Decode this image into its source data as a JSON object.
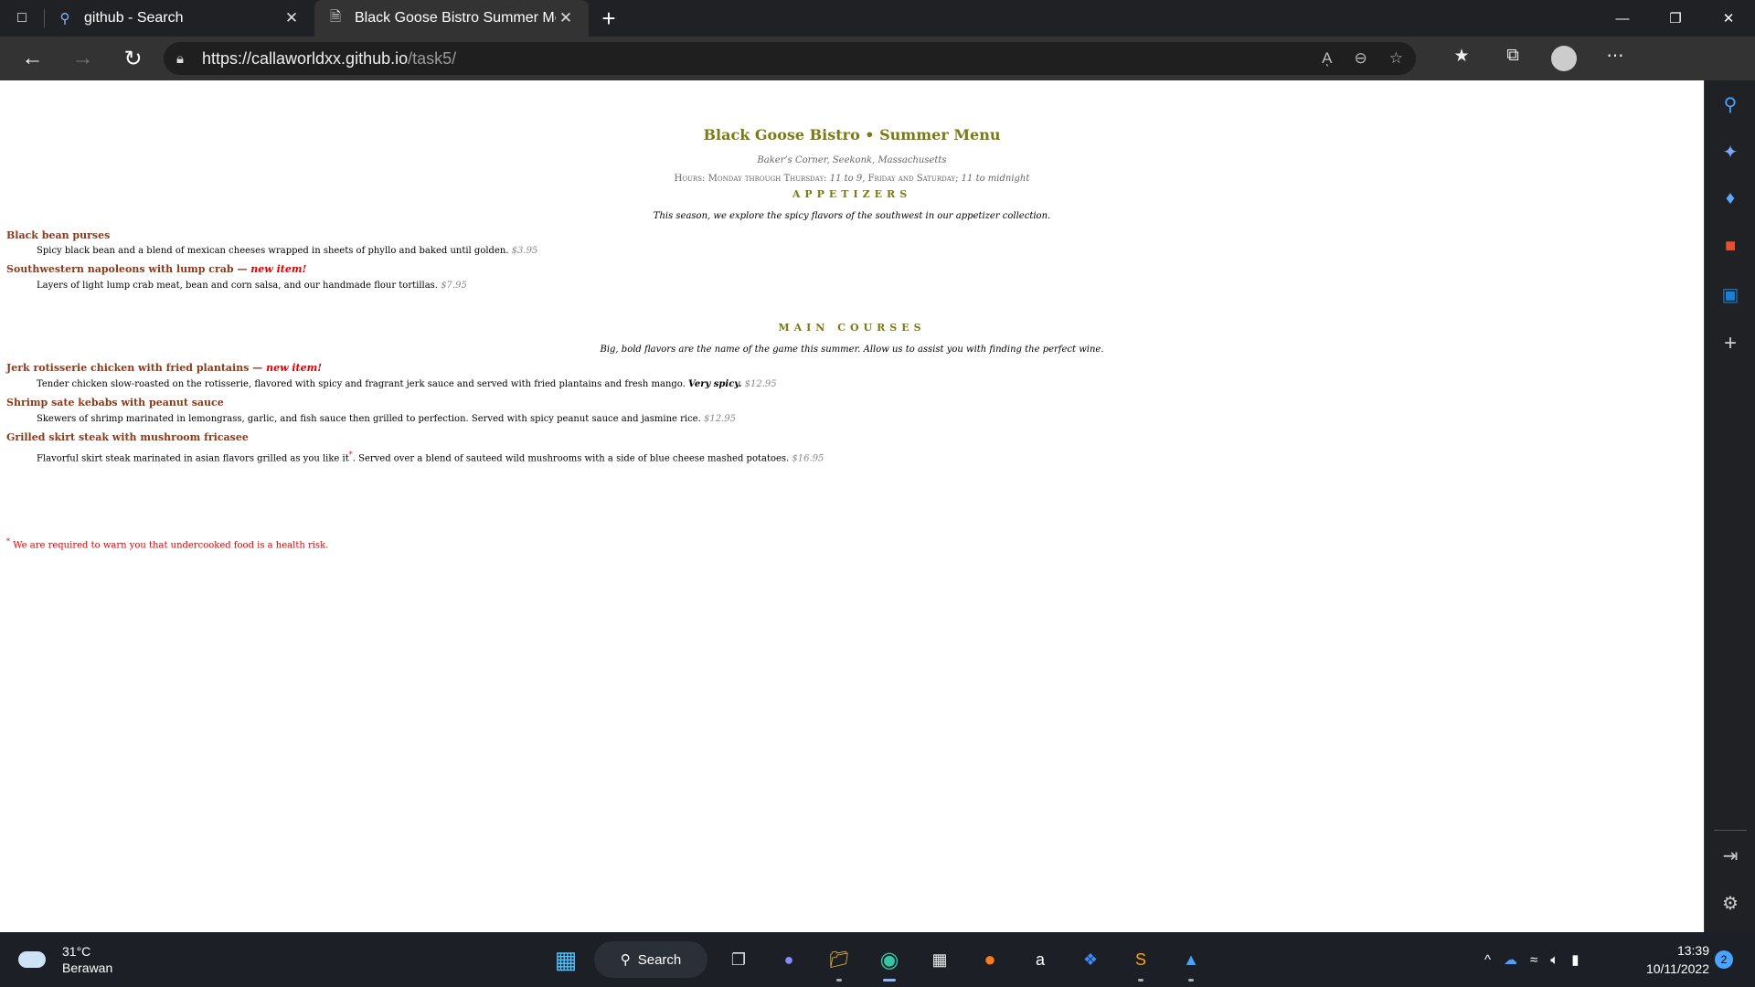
{
  "browser": {
    "tabs": [
      {
        "title": "github - Search"
      },
      {
        "title": "Black Goose Bistro Summer Menu"
      }
    ],
    "url_host": "https://callaworldxx.github.io",
    "url_path": "/task5/",
    "read_aloud_label": "Aͅ",
    "colors": {
      "chrome": "#202124",
      "toolbar": "#333333"
    }
  },
  "page": {
    "title": "Black Goose Bistro • Summer Menu",
    "address": "Baker’s Corner, Seekonk, Massachusetts",
    "hours_label": "Hours: Monday through Thursday:",
    "hours_weekday": "11 to 9,",
    "hours_weekend_label": "Friday and Saturday;",
    "hours_weekend": "11 to midnight",
    "appetizers": {
      "heading": "APPETIZERS",
      "intro": "This season, we explore the spicy flavors of the southwest in our appetizer collection.",
      "items": [
        {
          "name": "Black bean purses",
          "new": "",
          "desc": "Spicy black bean and a blend of mexican cheeses wrapped in sheets of phyllo and baked until golden.",
          "price": "$3.95"
        },
        {
          "name": "Southwestern napoleons with lump crab —",
          "new": "new item!",
          "desc": "Layers of light lump crab meat, bean and corn salsa, and our handmade flour tortillas.",
          "price": "$7.95"
        }
      ]
    },
    "main_courses": {
      "heading": "MAIN COURSES",
      "intro": "Big, bold flavors are the name of the game this summer. Allow us to assist you with finding the perfect wine.",
      "items": [
        {
          "name": "Jerk rotisserie chicken with fried plantains —",
          "new": "new item!",
          "desc": "Tender chicken slow-roasted on the rotisserie, flavored with spicy and fragrant jerk sauce and served with fried plantains and fresh mango.",
          "emph": "Very spicy.",
          "price": "$12.95"
        },
        {
          "name": "Shrimp sate kebabs with peanut sauce",
          "new": "",
          "desc": "Skewers of shrimp marinated in lemongrass, garlic, and fish sauce then grilled to perfection. Served with spicy peanut sauce and jasmine rice.",
          "price": "$12.95"
        },
        {
          "name": "Grilled skirt steak with mushroom fricasee",
          "new": "",
          "desc_a": "Flavorful skirt steak marinated in asian flavors grilled as you like it",
          "asterisk": "*",
          "desc_b": ". Served over a blend of sauteed wild mushrooms with a side of blue cheese mashed potatoes.",
          "price": "$16.95"
        }
      ]
    },
    "warning_mark": "*",
    "warning": "We are required to warn you that undercooked food is a health risk.",
    "colors": {
      "heading": "#7b7b14",
      "item": "#8b3a1a",
      "new": "#dd0000"
    }
  },
  "taskbar": {
    "temperature": "31°C",
    "condition": "Berawan",
    "search_label": "Search",
    "time": "13:39",
    "date": "10/11/2022",
    "notifications": "2"
  }
}
